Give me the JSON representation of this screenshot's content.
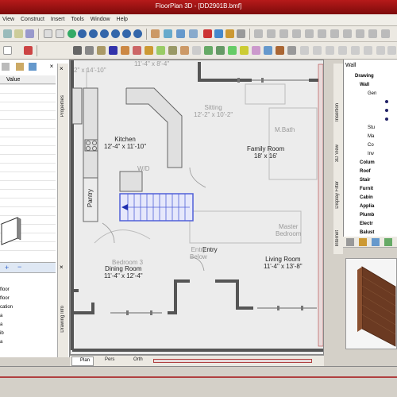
{
  "window": {
    "title": "FloorPlan 3D - [DD2901B.bmf]"
  },
  "menu": {
    "items": [
      "View",
      "Construct",
      "Insert",
      "Tools",
      "Window",
      "Help"
    ]
  },
  "properties": {
    "value_header": "Value",
    "tab_label": "Properties"
  },
  "left_tabs": {
    "drawing_info": "Drawing Info"
  },
  "layers": [
    "floor",
    "floor",
    "cation",
    "a",
    "a",
    "ib",
    "a"
  ],
  "drawing": {
    "dimension_top": "11'-4\" x 8'-4\"",
    "dimension_top2": "2\" x 14'-10\"",
    "rooms": [
      {
        "name": "Kitchen",
        "size": "12'-4\" x 11'-10\""
      },
      {
        "name": "Family Room",
        "size": "18' x 16'"
      },
      {
        "name": "Dining Room",
        "size": "11'-4\" x 12'-4\""
      },
      {
        "name": "Living Room",
        "size": "11'-4\" x 13'-8\""
      },
      {
        "name": "Entry",
        "size": ""
      },
      {
        "name": "Pantry",
        "size": ""
      }
    ],
    "ghost_labels": [
      {
        "name": "Sitting",
        "size": "12'-2\" x 10'-2\""
      },
      {
        "name": "M.Bath",
        "size": ""
      },
      {
        "name": "Master",
        "size": "Bedroom"
      },
      {
        "name": "Bedroom 3",
        "size": ""
      },
      {
        "name": "Entry",
        "size": "Below"
      },
      {
        "name": "W/D",
        "size": ""
      }
    ]
  },
  "view_tabs": [
    "Plan",
    "Pers",
    "Orth"
  ],
  "right_panel": {
    "header": "Wall",
    "tree": [
      {
        "label": "Drawing",
        "bold": true
      },
      {
        "label": "Wall",
        "bold": true
      },
      {
        "label": "Gen",
        "bold": false
      },
      {
        "label": "Stu",
        "bold": false
      },
      {
        "label": "Ma",
        "bold": false
      },
      {
        "label": "Co",
        "bold": false
      },
      {
        "label": "Inv",
        "bold": false
      },
      {
        "label": "Colum",
        "bold": true
      },
      {
        "label": "Roof",
        "bold": true
      },
      {
        "label": "Stair",
        "bold": true
      },
      {
        "label": "Furnit",
        "bold": true
      },
      {
        "label": "Cabin",
        "bold": true
      },
      {
        "label": "Applia",
        "bold": true
      },
      {
        "label": "Plumb",
        "bold": true
      },
      {
        "label": "Electr",
        "bold": true
      },
      {
        "label": "Balust",
        "bold": true
      }
    ],
    "vtabs": [
      "Insertion",
      "3D View",
      "Display Filter",
      "Internet"
    ]
  },
  "colors": {
    "title_bar": "#b61a1a",
    "wall": "#555555",
    "stair_blue": "#5060d8",
    "brick": "#6b3a22"
  }
}
